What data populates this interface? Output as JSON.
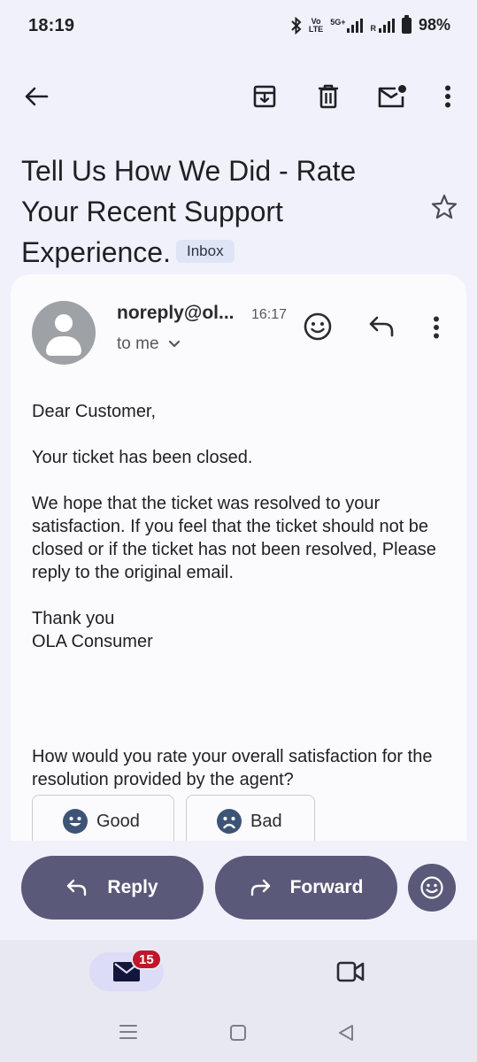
{
  "status_bar": {
    "time": "18:19",
    "volte_top": "Vo",
    "volte_bottom": "LTE",
    "network": "5G+",
    "roaming": "R",
    "battery": "98%"
  },
  "toolbar": {
    "back_icon": "arrow-left-icon",
    "archive_icon": "archive-icon",
    "delete_icon": "trash-icon",
    "mark_unread_icon": "mail-unread-icon",
    "more_icon": "more-vertical-icon"
  },
  "email": {
    "subject": "Tell Us How We Did - Rate Your Recent Support Experience.",
    "label": "Inbox",
    "sender": "noreply@ol...",
    "time": "16:17",
    "recipient": "to me",
    "greeting": "Dear Customer,",
    "line1": "Your ticket has been closed.",
    "line2": "We hope that the ticket was resolved to your satisfaction. If you feel that the ticket should not be closed or if the ticket has not been resolved, Please reply to the original email.",
    "signoff1": "Thank you",
    "signoff2": "OLA Consumer",
    "question": "How would you rate your overall satisfaction for the resolution provided by the agent?",
    "good_label": "Good",
    "bad_label": "Bad"
  },
  "actions": {
    "reply": "Reply",
    "forward": "Forward"
  },
  "nav": {
    "mail_badge": "15"
  },
  "colors": {
    "accent": "#5a5979",
    "badge": "#c0162c",
    "chip": "#dfe4f7"
  }
}
